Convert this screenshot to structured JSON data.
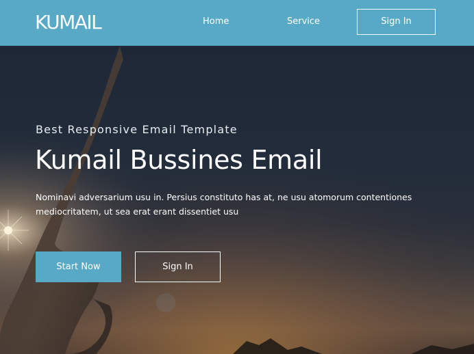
{
  "header": {
    "logo": "KUMAIL",
    "nav": {
      "home": "Home",
      "service": "Service",
      "signin": "Sign In"
    }
  },
  "hero": {
    "subtitle": "Best Responsive Email Template",
    "title": "Kumail Bussines Email",
    "text": "Nominavi adversarium usu in. Persius constituto has at, ne usu atomorum contentiones mediocritatem, ut sea erat erant dissentiet usu",
    "buttons": {
      "start": "Start Now",
      "signin": "Sign In"
    }
  },
  "colors": {
    "accent": "#58a9c5",
    "hero_dark": "#1f2a38",
    "white": "#ffffff"
  }
}
